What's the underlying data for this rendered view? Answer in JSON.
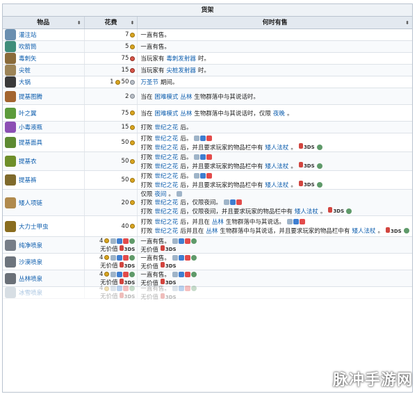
{
  "caption": "货架",
  "headers": {
    "item": "物品",
    "cost": "花费",
    "when": "何时有售",
    "sort_glyph": "⬍"
  },
  "rows": [
    {
      "name": "灌注站",
      "icon_color": "#6a8fb0",
      "cost": [
        {
          "amount": "7",
          "coin": "gold"
        }
      ],
      "when": [
        [
          {
            "t": "一直有售。"
          }
        ]
      ]
    },
    {
      "name": "吹箭筒",
      "icon_color": "#3f8d7a",
      "cost": [
        {
          "amount": "5",
          "coin": "gold"
        }
      ],
      "when": [
        [
          {
            "t": "一直有售。"
          }
        ]
      ]
    },
    {
      "name": "毒刺矢",
      "icon_color": "#8a6b3a",
      "cost": [
        {
          "amount": "75",
          "coin": "red"
        }
      ],
      "when": [
        [
          {
            "t": "当玩家有"
          },
          {
            "t": "毒刺发射器",
            "link": true
          },
          {
            "t": "时。"
          }
        ]
      ]
    },
    {
      "name": "尖桩",
      "icon_color": "#9c8457",
      "cost": [
        {
          "amount": "15",
          "coin": "red"
        }
      ],
      "when": [
        [
          {
            "t": "当玩家有"
          },
          {
            "t": "尖桩发射器",
            "link": true
          },
          {
            "t": "时。"
          }
        ]
      ]
    },
    {
      "name": "大锅",
      "icon_color": "#3a3a3a",
      "cost": [
        {
          "amount": "1",
          "coin": "gold"
        },
        {
          "amount": "50",
          "coin": "silver"
        }
      ],
      "when": [
        [
          {
            "t": "万圣节",
            "link": true
          },
          {
            "t": "期间。"
          }
        ]
      ]
    },
    {
      "name": "提基图腾",
      "icon_color": "#a3652f",
      "cost": [
        {
          "amount": "2",
          "coin": "silver"
        }
      ],
      "when": [
        [
          {
            "t": "当在"
          },
          {
            "t": "困难模式",
            "link": true
          },
          {
            "t": "丛林",
            "link": true
          },
          {
            "t": "生物群落中与其说话时。"
          }
        ]
      ]
    },
    {
      "name": "叶之翼",
      "icon_color": "#5c9b3c",
      "cost": [
        {
          "amount": "75",
          "coin": "gold"
        }
      ],
      "when": [
        [
          {
            "t": "当在"
          },
          {
            "t": "困难模式",
            "link": true
          },
          {
            "t": "丛林",
            "link": true
          },
          {
            "t": "生物群落中与其说话时，仅限"
          },
          {
            "t": "夜晚",
            "link": true
          },
          {
            "t": "。"
          }
        ]
      ]
    },
    {
      "name": "小毒液瓶",
      "icon_color": "#8c4fb4",
      "cost": [
        {
          "amount": "15",
          "coin": "gold"
        }
      ],
      "when": [
        [
          {
            "t": "打败"
          },
          {
            "t": "世纪之花",
            "link": true
          },
          {
            "t": "后。"
          }
        ]
      ]
    },
    {
      "name": "提基面具",
      "icon_color": "#5d8a32",
      "cost": [
        {
          "amount": "50",
          "coin": "gold"
        }
      ],
      "when": [
        [
          {
            "t": "打败"
          },
          {
            "t": "世纪之花",
            "link": true
          },
          {
            "t": "后。"
          },
          {
            "plats": "abc"
          }
        ],
        [
          {
            "t": "打败"
          },
          {
            "t": "世纪之花",
            "link": true
          },
          {
            "t": "后，并且要求玩家的物品栏中有"
          },
          {
            "t": "矮人法杖",
            "link": true
          },
          {
            "t": "。"
          },
          {
            "ds": "3DS"
          },
          {
            "plats": "d"
          }
        ]
      ]
    },
    {
      "name": "提基衣",
      "icon_color": "#6e8f2a",
      "cost": [
        {
          "amount": "50",
          "coin": "gold"
        }
      ],
      "when": [
        [
          {
            "t": "打败"
          },
          {
            "t": "世纪之花",
            "link": true
          },
          {
            "t": "后。"
          },
          {
            "plats": "abc"
          }
        ],
        [
          {
            "t": "打败"
          },
          {
            "t": "世纪之花",
            "link": true
          },
          {
            "t": "后，并且要求玩家的物品栏中有"
          },
          {
            "t": "矮人法杖",
            "link": true
          },
          {
            "t": "。"
          },
          {
            "ds": "3DS"
          },
          {
            "plats": "d"
          }
        ]
      ]
    },
    {
      "name": "提基裤",
      "icon_color": "#7f6a2c",
      "cost": [
        {
          "amount": "50",
          "coin": "gold"
        }
      ],
      "when": [
        [
          {
            "t": "打败"
          },
          {
            "t": "世纪之花",
            "link": true
          },
          {
            "t": "后。"
          },
          {
            "plats": "abc"
          }
        ],
        [
          {
            "t": "打败"
          },
          {
            "t": "世纪之花",
            "link": true
          },
          {
            "t": "后，并且要求玩家的物品栏中有"
          },
          {
            "t": "矮人法杖",
            "link": true
          },
          {
            "t": "。"
          },
          {
            "ds": "3DS"
          },
          {
            "plats": "d"
          }
        ]
      ]
    },
    {
      "name": "矮人项链",
      "icon_color": "#b08a4d",
      "cost": [
        {
          "amount": "20",
          "coin": "gold"
        }
      ],
      "when": [
        [
          {
            "t": "仅限"
          },
          {
            "t": "夜间",
            "link": true
          },
          {
            "t": "。"
          },
          {
            "plats": "a"
          }
        ],
        [
          {
            "t": "打败"
          },
          {
            "t": "世纪之花",
            "link": true
          },
          {
            "t": "后，仅限夜间。"
          },
          {
            "plats": "abc"
          }
        ],
        [
          {
            "t": "打败"
          },
          {
            "t": "世纪之花",
            "link": true
          },
          {
            "t": "后，仅限夜间，并且要求玩家的物品栏中有"
          },
          {
            "t": "矮人法杖",
            "link": true
          },
          {
            "t": "。"
          },
          {
            "ds": "3DS"
          },
          {
            "plats": "d"
          }
        ]
      ]
    },
    {
      "name": "大力士甲虫",
      "icon_color": "#8a6d1f",
      "cost": [
        {
          "amount": "40",
          "coin": "gold"
        }
      ],
      "when": [
        [
          {
            "t": "打败"
          },
          {
            "t": "世纪之花",
            "link": true
          },
          {
            "t": "后，并且在"
          },
          {
            "t": "丛林",
            "link": true
          },
          {
            "t": "生物群落中与其说话。"
          },
          {
            "plats": "abc"
          }
        ],
        [
          {
            "t": "打败"
          },
          {
            "t": "世纪之花",
            "link": true
          },
          {
            "t": "后并且在"
          },
          {
            "t": "丛林",
            "link": true
          },
          {
            "t": "生物群落中与其说话，并且要求玩家的物品栏中有"
          },
          {
            "t": "矮人法杖",
            "link": true
          },
          {
            "t": "。"
          },
          {
            "ds": "3DS"
          },
          {
            "plats": "d"
          }
        ]
      ]
    },
    {
      "name": "纯净喷泉",
      "icon_color": "#777e88",
      "cost": [
        {
          "amount": "4",
          "coin": "gold",
          "plats": "abcd"
        },
        {
          "amount": "无价值",
          "ds": "3DS"
        }
      ],
      "when": [
        [
          {
            "t": "一直有售。"
          },
          {
            "plats": "abcd"
          }
        ],
        [
          {
            "t": "无价值"
          },
          {
            "ds": "3DS"
          }
        ]
      ]
    },
    {
      "name": "沙漠喷泉",
      "icon_color": "#6d747d",
      "cost": [
        {
          "amount": "4",
          "coin": "gold",
          "plats": "abcd"
        },
        {
          "amount": "无价值",
          "ds": "3DS"
        }
      ],
      "when": [
        [
          {
            "t": "一直有售。"
          },
          {
            "plats": "abcd"
          }
        ],
        [
          {
            "t": "无价值"
          },
          {
            "ds": "3DS"
          }
        ]
      ]
    },
    {
      "name": "丛林喷泉",
      "icon_color": "#6a7078",
      "cost": [
        {
          "amount": "4",
          "coin": "gold",
          "plats": "abcd"
        },
        {
          "amount": "无价值",
          "ds": "3DS"
        }
      ],
      "when": [
        [
          {
            "t": "一直有售。"
          },
          {
            "plats": "abcd"
          }
        ],
        [
          {
            "t": "无价值"
          },
          {
            "ds": "3DS"
          }
        ]
      ]
    },
    {
      "name": "冰雪喷泉",
      "icon_color": "#8fa2b4",
      "fade": true,
      "cost": [
        {
          "amount": "4",
          "coin": "gold",
          "plats": "abcd"
        },
        {
          "amount": "无价值",
          "ds": "3DS"
        }
      ],
      "when": [
        [
          {
            "t": "一直有售。"
          },
          {
            "plats": "abcd"
          }
        ],
        [
          {
            "t": "无价值"
          },
          {
            "ds": "3DS"
          }
        ]
      ]
    }
  ],
  "watermark": "脉冲手游网"
}
